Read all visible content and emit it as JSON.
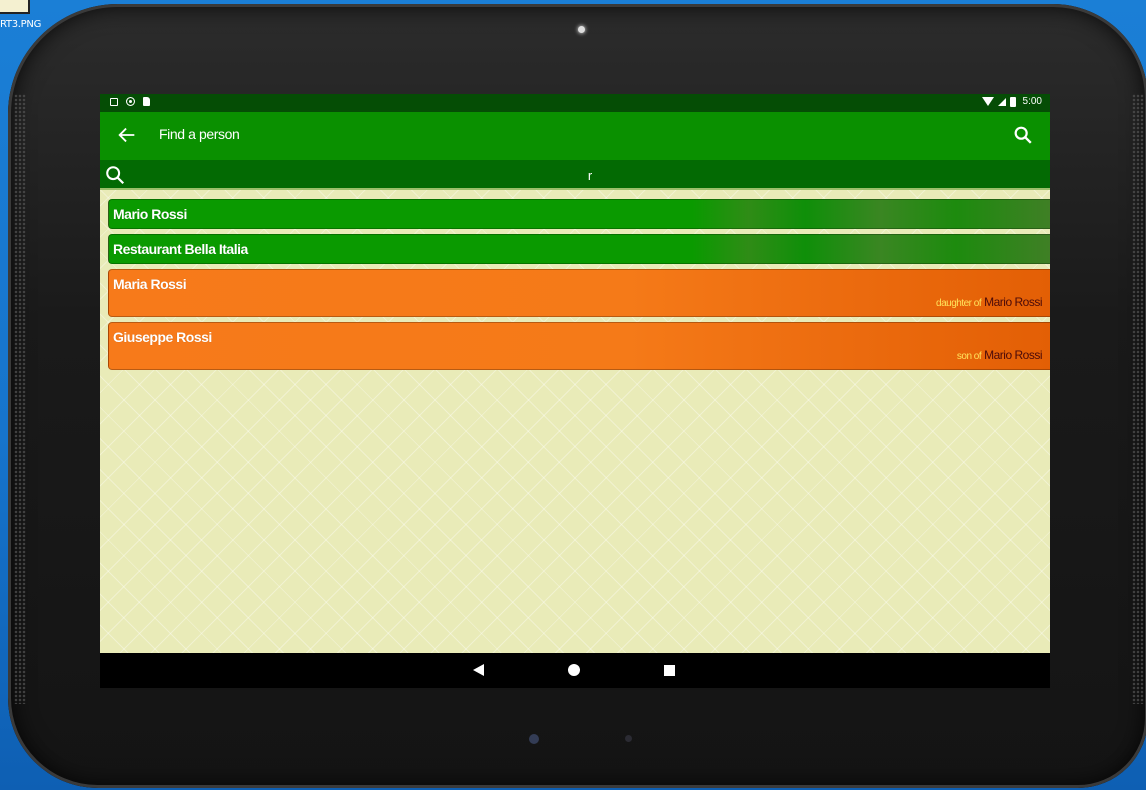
{
  "desktop": {
    "file_label": "RT3.PNG"
  },
  "status_bar": {
    "time": "5:00"
  },
  "toolbar": {
    "title": "Find a person"
  },
  "search": {
    "value": "r"
  },
  "results": [
    {
      "kind": "business",
      "name": "Mario Rossi"
    },
    {
      "kind": "business",
      "name": "Restaurant Bella Italia"
    },
    {
      "kind": "relative",
      "name": "Maria Rossi",
      "relation": "daughter of",
      "relation_target": "Mario Rossi"
    },
    {
      "kind": "relative",
      "name": "Giuseppe Rossi",
      "relation": "son of",
      "relation_target": "Mario Rossi"
    }
  ],
  "colors": {
    "toolbar": "#0a9000",
    "status_bar": "#054d05",
    "search_bar": "#036a03",
    "business_row": "#0a9a00",
    "relative_row": "#f77a1a",
    "background": "#e9ebb8"
  },
  "icons": {
    "back": "arrow-left-icon",
    "search": "search-icon",
    "nav_back": "triangle-back-icon",
    "nav_home": "circle-home-icon",
    "nav_recent": "square-recents-icon"
  }
}
